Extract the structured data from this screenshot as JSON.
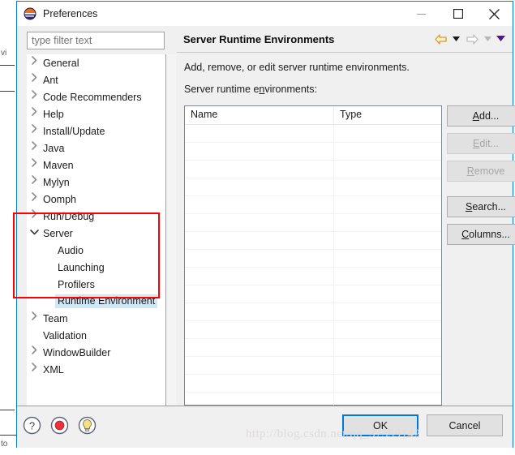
{
  "window": {
    "title": "Preferences",
    "icon": "eclipse-icon",
    "controls": {
      "minimize": "—",
      "maximize": "□",
      "close": "✕"
    },
    "accent": "#0078d7"
  },
  "background": {
    "left_text": "vi",
    "bottom_text": "to"
  },
  "filter": {
    "placeholder": "type filter text",
    "value": ""
  },
  "tree": {
    "items": [
      {
        "label": "General",
        "level": 0,
        "twisty": "collapsed",
        "selected": false
      },
      {
        "label": "Ant",
        "level": 0,
        "twisty": "collapsed",
        "selected": false
      },
      {
        "label": "Code Recommenders",
        "level": 0,
        "twisty": "collapsed",
        "selected": false
      },
      {
        "label": "Help",
        "level": 0,
        "twisty": "collapsed",
        "selected": false
      },
      {
        "label": "Install/Update",
        "level": 0,
        "twisty": "collapsed",
        "selected": false
      },
      {
        "label": "Java",
        "level": 0,
        "twisty": "collapsed",
        "selected": false
      },
      {
        "label": "Maven",
        "level": 0,
        "twisty": "collapsed",
        "selected": false
      },
      {
        "label": "Mylyn",
        "level": 0,
        "twisty": "collapsed",
        "selected": false
      },
      {
        "label": "Oomph",
        "level": 0,
        "twisty": "collapsed",
        "selected": false
      },
      {
        "label": "Run/Debug",
        "level": 0,
        "twisty": "collapsed",
        "selected": false
      },
      {
        "label": "Server",
        "level": 0,
        "twisty": "expanded",
        "selected": false
      },
      {
        "label": "Audio",
        "level": 1,
        "twisty": "none",
        "selected": false
      },
      {
        "label": "Launching",
        "level": 1,
        "twisty": "none",
        "selected": false
      },
      {
        "label": "Profilers",
        "level": 1,
        "twisty": "none",
        "selected": false
      },
      {
        "label": "Runtime Environment",
        "level": 1,
        "twisty": "none",
        "selected": true
      },
      {
        "label": "Team",
        "level": 0,
        "twisty": "collapsed",
        "selected": false
      },
      {
        "label": "Validation",
        "level": 0,
        "twisty": "none",
        "selected": false
      },
      {
        "label": "WindowBuilder",
        "level": 0,
        "twisty": "collapsed",
        "selected": false
      },
      {
        "label": "XML",
        "level": 0,
        "twisty": "collapsed",
        "selected": false
      }
    ],
    "twisty_collapsed": "›",
    "twisty_expanded": "ⱟ",
    "scrollbar": {
      "left_arrow": "‹",
      "right_arrow": "›"
    }
  },
  "annotation": {
    "color": "#ff0000",
    "target": "Server subtree"
  },
  "page": {
    "title": "Server Runtime Environments",
    "description": "Add, remove, or edit server runtime environments.",
    "list_label_pre": "Server runtime e",
    "list_label_mnemonic": "n",
    "list_label_post": "vironments:",
    "nav": {
      "back_icon": "back-arrow-icon",
      "back_caret": "▾",
      "forward_icon": "forward-arrow-icon",
      "forward_caret": "▾",
      "menu_caret": "▾",
      "back_color": "#e8a33d",
      "forward_color": "#b8b8b8",
      "menu_color": "#4b1f78"
    }
  },
  "table": {
    "columns": [
      {
        "key": "name",
        "label": "Name"
      },
      {
        "key": "type",
        "label": "Type"
      }
    ],
    "rows": [],
    "empty_row_count": 16
  },
  "side_buttons": [
    {
      "id": "add",
      "pre": "",
      "mnemonic": "A",
      "post": "dd...",
      "disabled": false,
      "gap": false
    },
    {
      "id": "edit",
      "pre": "",
      "mnemonic": "E",
      "post": "dit...",
      "disabled": true,
      "gap": false
    },
    {
      "id": "remove",
      "pre": "",
      "mnemonic": "R",
      "post": "emove",
      "disabled": true,
      "gap": false
    },
    {
      "id": "search",
      "pre": "",
      "mnemonic": "S",
      "post": "earch...",
      "disabled": false,
      "gap": true
    },
    {
      "id": "columns",
      "pre": "",
      "mnemonic": "C",
      "post": "olumns...",
      "disabled": false,
      "gap": false
    }
  ],
  "footer": {
    "icons": [
      {
        "id": "help-icon",
        "glyph": "?"
      },
      {
        "id": "record-icon",
        "glyph": ""
      },
      {
        "id": "tip-icon",
        "glyph": ""
      }
    ],
    "ok_label": "OK",
    "cancel_label": "Cancel"
  },
  "watermark": "http://blog.csdn.net/qq_37359142"
}
